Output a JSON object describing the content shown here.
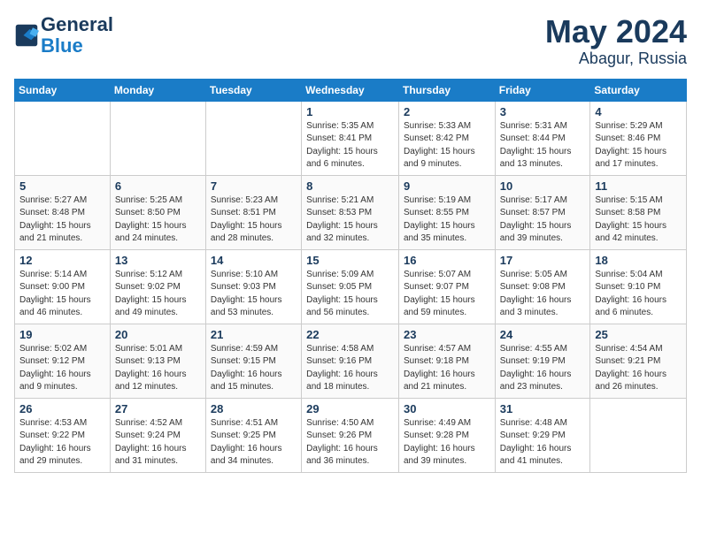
{
  "header": {
    "logo_line1": "General",
    "logo_line2": "Blue",
    "month": "May 2024",
    "location": "Abagur, Russia"
  },
  "columns": [
    "Sunday",
    "Monday",
    "Tuesday",
    "Wednesday",
    "Thursday",
    "Friday",
    "Saturday"
  ],
  "weeks": [
    [
      {
        "day": "",
        "info": ""
      },
      {
        "day": "",
        "info": ""
      },
      {
        "day": "",
        "info": ""
      },
      {
        "day": "1",
        "info": "Sunrise: 5:35 AM\nSunset: 8:41 PM\nDaylight: 15 hours\nand 6 minutes."
      },
      {
        "day": "2",
        "info": "Sunrise: 5:33 AM\nSunset: 8:42 PM\nDaylight: 15 hours\nand 9 minutes."
      },
      {
        "day": "3",
        "info": "Sunrise: 5:31 AM\nSunset: 8:44 PM\nDaylight: 15 hours\nand 13 minutes."
      },
      {
        "day": "4",
        "info": "Sunrise: 5:29 AM\nSunset: 8:46 PM\nDaylight: 15 hours\nand 17 minutes."
      }
    ],
    [
      {
        "day": "5",
        "info": "Sunrise: 5:27 AM\nSunset: 8:48 PM\nDaylight: 15 hours\nand 21 minutes."
      },
      {
        "day": "6",
        "info": "Sunrise: 5:25 AM\nSunset: 8:50 PM\nDaylight: 15 hours\nand 24 minutes."
      },
      {
        "day": "7",
        "info": "Sunrise: 5:23 AM\nSunset: 8:51 PM\nDaylight: 15 hours\nand 28 minutes."
      },
      {
        "day": "8",
        "info": "Sunrise: 5:21 AM\nSunset: 8:53 PM\nDaylight: 15 hours\nand 32 minutes."
      },
      {
        "day": "9",
        "info": "Sunrise: 5:19 AM\nSunset: 8:55 PM\nDaylight: 15 hours\nand 35 minutes."
      },
      {
        "day": "10",
        "info": "Sunrise: 5:17 AM\nSunset: 8:57 PM\nDaylight: 15 hours\nand 39 minutes."
      },
      {
        "day": "11",
        "info": "Sunrise: 5:15 AM\nSunset: 8:58 PM\nDaylight: 15 hours\nand 42 minutes."
      }
    ],
    [
      {
        "day": "12",
        "info": "Sunrise: 5:14 AM\nSunset: 9:00 PM\nDaylight: 15 hours\nand 46 minutes."
      },
      {
        "day": "13",
        "info": "Sunrise: 5:12 AM\nSunset: 9:02 PM\nDaylight: 15 hours\nand 49 minutes."
      },
      {
        "day": "14",
        "info": "Sunrise: 5:10 AM\nSunset: 9:03 PM\nDaylight: 15 hours\nand 53 minutes."
      },
      {
        "day": "15",
        "info": "Sunrise: 5:09 AM\nSunset: 9:05 PM\nDaylight: 15 hours\nand 56 minutes."
      },
      {
        "day": "16",
        "info": "Sunrise: 5:07 AM\nSunset: 9:07 PM\nDaylight: 15 hours\nand 59 minutes."
      },
      {
        "day": "17",
        "info": "Sunrise: 5:05 AM\nSunset: 9:08 PM\nDaylight: 16 hours\nand 3 minutes."
      },
      {
        "day": "18",
        "info": "Sunrise: 5:04 AM\nSunset: 9:10 PM\nDaylight: 16 hours\nand 6 minutes."
      }
    ],
    [
      {
        "day": "19",
        "info": "Sunrise: 5:02 AM\nSunset: 9:12 PM\nDaylight: 16 hours\nand 9 minutes."
      },
      {
        "day": "20",
        "info": "Sunrise: 5:01 AM\nSunset: 9:13 PM\nDaylight: 16 hours\nand 12 minutes."
      },
      {
        "day": "21",
        "info": "Sunrise: 4:59 AM\nSunset: 9:15 PM\nDaylight: 16 hours\nand 15 minutes."
      },
      {
        "day": "22",
        "info": "Sunrise: 4:58 AM\nSunset: 9:16 PM\nDaylight: 16 hours\nand 18 minutes."
      },
      {
        "day": "23",
        "info": "Sunrise: 4:57 AM\nSunset: 9:18 PM\nDaylight: 16 hours\nand 21 minutes."
      },
      {
        "day": "24",
        "info": "Sunrise: 4:55 AM\nSunset: 9:19 PM\nDaylight: 16 hours\nand 23 minutes."
      },
      {
        "day": "25",
        "info": "Sunrise: 4:54 AM\nSunset: 9:21 PM\nDaylight: 16 hours\nand 26 minutes."
      }
    ],
    [
      {
        "day": "26",
        "info": "Sunrise: 4:53 AM\nSunset: 9:22 PM\nDaylight: 16 hours\nand 29 minutes."
      },
      {
        "day": "27",
        "info": "Sunrise: 4:52 AM\nSunset: 9:24 PM\nDaylight: 16 hours\nand 31 minutes."
      },
      {
        "day": "28",
        "info": "Sunrise: 4:51 AM\nSunset: 9:25 PM\nDaylight: 16 hours\nand 34 minutes."
      },
      {
        "day": "29",
        "info": "Sunrise: 4:50 AM\nSunset: 9:26 PM\nDaylight: 16 hours\nand 36 minutes."
      },
      {
        "day": "30",
        "info": "Sunrise: 4:49 AM\nSunset: 9:28 PM\nDaylight: 16 hours\nand 39 minutes."
      },
      {
        "day": "31",
        "info": "Sunrise: 4:48 AM\nSunset: 9:29 PM\nDaylight: 16 hours\nand 41 minutes."
      },
      {
        "day": "",
        "info": ""
      }
    ]
  ]
}
